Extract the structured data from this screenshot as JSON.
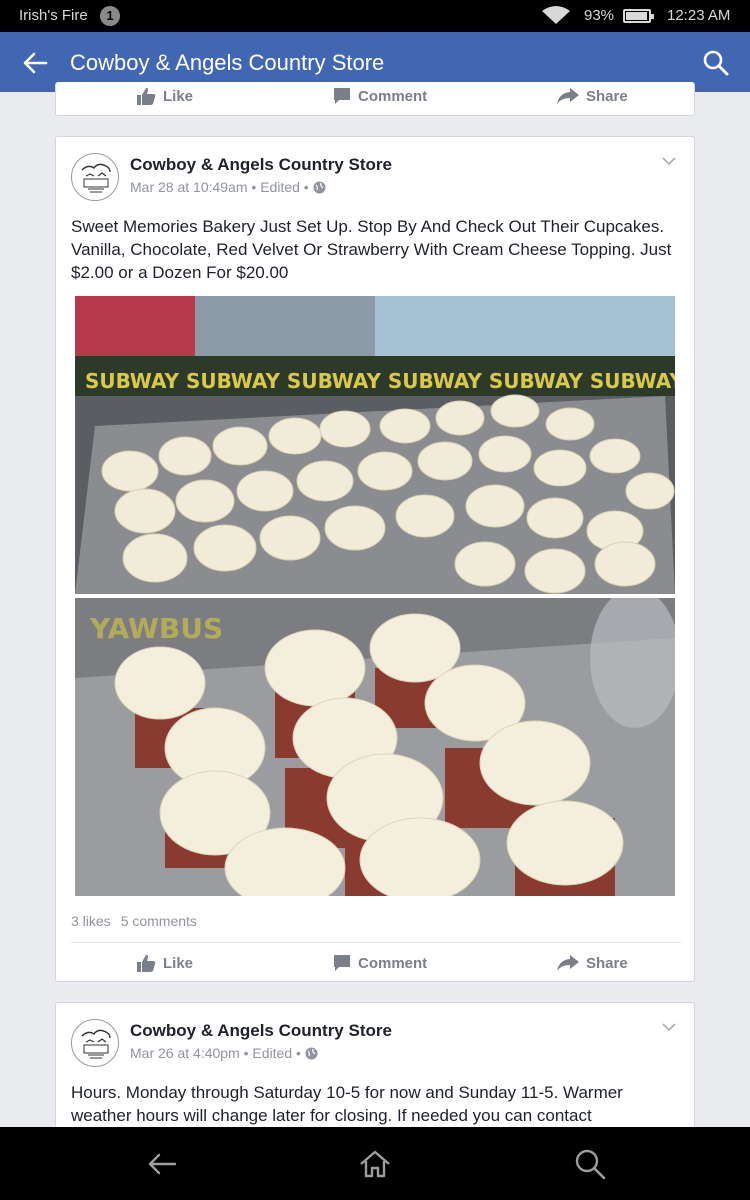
{
  "status_bar": {
    "carrier": "Irish's Fire",
    "notification_count": "1",
    "battery": "93%",
    "time": "12:23 AM"
  },
  "app_bar": {
    "title": "Cowboy & Angels Country Store",
    "back_icon": "arrow-left-icon",
    "search_icon": "search-icon"
  },
  "actions": {
    "like": "Like",
    "comment": "Comment",
    "share": "Share"
  },
  "posts": [
    {
      "page_name": "Cowboy & Angels Country Store",
      "meta": "Mar 28 at 10:49am • Edited •",
      "text": "Sweet Memories Bakery Just Set Up. Stop By And Check Out Their Cupcakes. Vanilla, Chocolate, Red Velvet Or Strawberry With Cream Cheese Topping. Just $2.00 or a Dozen For $20.00",
      "likes": "3 likes",
      "comments": "5 comments"
    },
    {
      "page_name": "Cowboy & Angels Country Store",
      "meta": "Mar 26 at 4:40pm • Edited •",
      "text": "Hours. Monday through Saturday 10-5 for now and Sunday 11-5. Warmer weather hours will change later for closing. If needed you can contact"
    }
  ],
  "colors": {
    "brand_blue": "#4267b2",
    "feed_bg": "#e9ebee",
    "action_gray": "#7a7f89",
    "meta_gray": "#90949c"
  }
}
